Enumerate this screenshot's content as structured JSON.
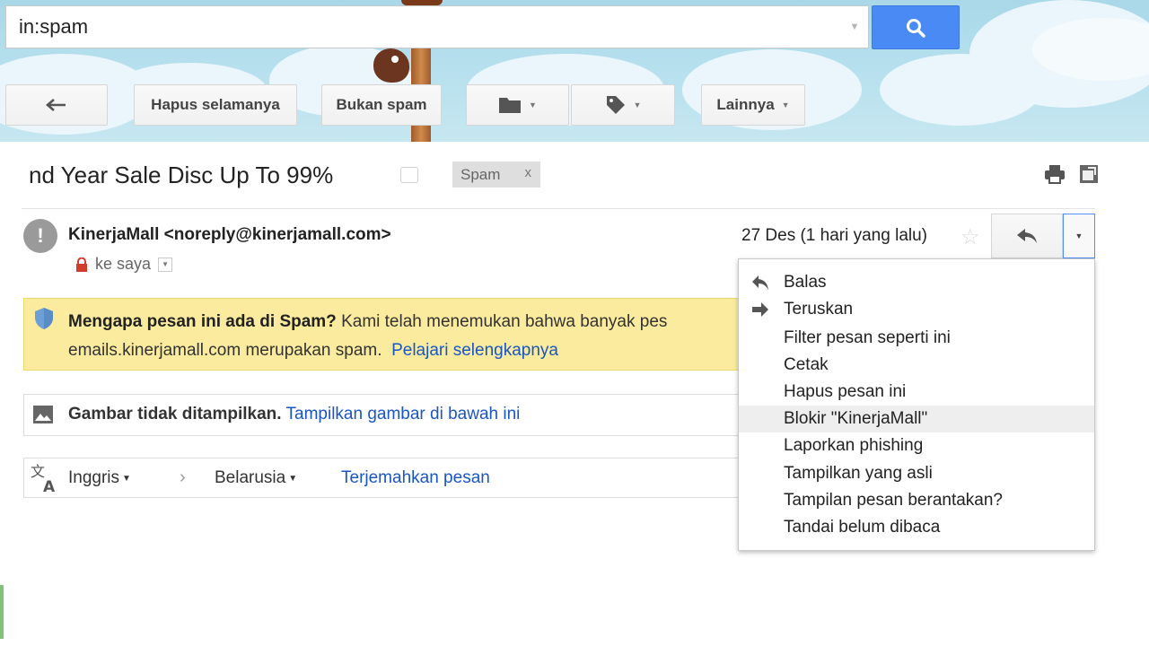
{
  "search": {
    "value": "in:spam"
  },
  "toolbar": {
    "delete_forever": "Hapus selamanya",
    "not_spam": "Bukan spam",
    "more": "Lainnya"
  },
  "message": {
    "subject": "nd Year Sale Disc Up To 99%",
    "label": "Spam",
    "label_remove": "x",
    "avatar_glyph": "!",
    "sender": "KinerjaMall <noreply@kinerjamall.com>",
    "to": "ke saya",
    "date": "27 Des (1 hari yang lalu)"
  },
  "spam_warning": {
    "title": "Mengapa pesan ini ada di Spam?",
    "text1": "Kami telah menemukan bahwa banyak pes",
    "text2": "emails.kinerjamall.com merupakan spam.",
    "link": "Pelajari selengkapnya"
  },
  "images_notice": {
    "title": "Gambar tidak ditampilkan.",
    "link": "Tampilkan gambar di bawah ini"
  },
  "translate": {
    "from": "Inggris",
    "to": "Belarusia",
    "link": "Terjemahkan pesan"
  },
  "menu": {
    "items": [
      {
        "label": "Balas",
        "icon": "reply-icon"
      },
      {
        "label": "Teruskan",
        "icon": "forward-icon"
      },
      {
        "label": "Filter pesan seperti ini"
      },
      {
        "label": "Cetak"
      },
      {
        "label": "Hapus pesan ini"
      },
      {
        "label": "Blokir \"KinerjaMall\"",
        "highlighted": true
      },
      {
        "label": "Laporkan phishing"
      },
      {
        "label": "Tampilkan yang asli"
      },
      {
        "label": "Tampilan pesan berantakan?"
      },
      {
        "label": "Tandai belum dibaca"
      }
    ]
  },
  "colors": {
    "search_button": "#4a8af4",
    "link": "#1a55c4",
    "spam_banner": "#faeb9e",
    "menu_hover": "#eeeeee"
  }
}
